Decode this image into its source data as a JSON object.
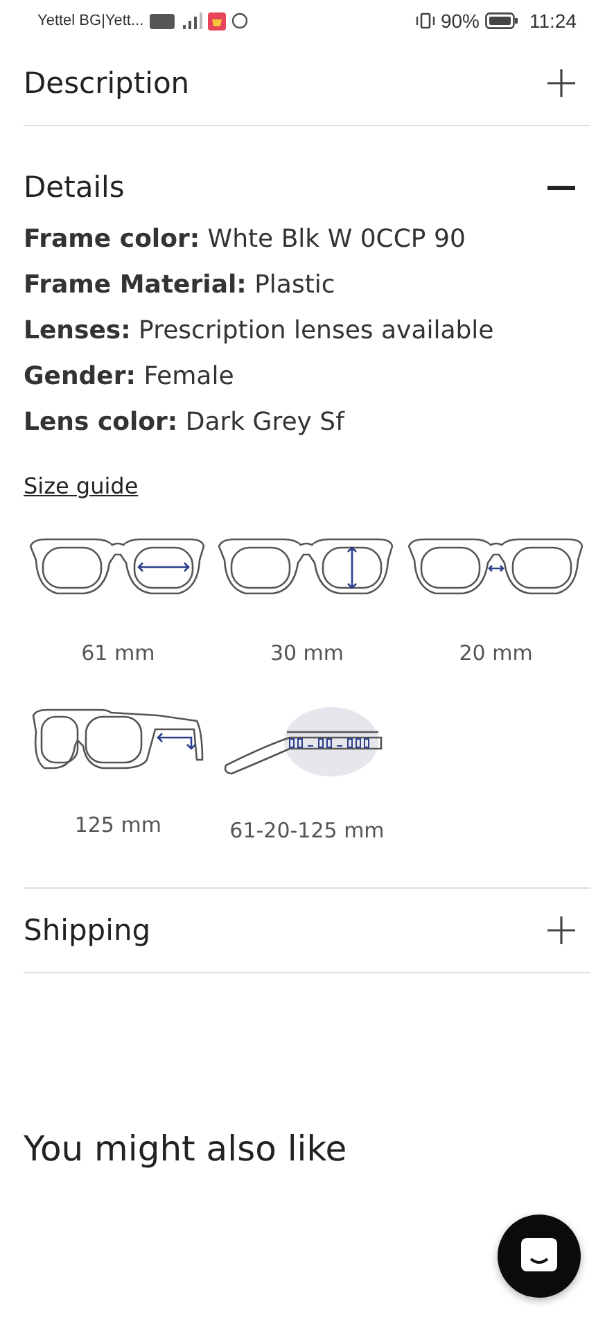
{
  "status_bar": {
    "carrier": "Yettel BG|Yett...",
    "battery_percent": "90%",
    "time": "11:24"
  },
  "sections": [
    {
      "title": "Description",
      "expanded": false
    },
    {
      "title": "Details",
      "expanded": true,
      "specs": [
        "**Frame color:** Whte Blk W 0CCP 90",
        "**Frame Material:** Plastic",
        "**Lenses:** Prescription lenses available",
        "**Gender:** Female",
        "**Lens color:** Dark Grey Sf"
      ],
      "size_guide": {
        "link": "Size guide",
        "items": [
          {
            "kind": "lens-width",
            "label": "61 mm"
          },
          {
            "kind": "lens-height",
            "label": "30 mm"
          },
          {
            "kind": "bridge",
            "label": "20 mm"
          },
          {
            "kind": "temple",
            "label": "125 mm"
          },
          {
            "kind": "inscription",
            "label": "61-20-125 mm"
          }
        ]
      }
    },
    {
      "title": "Shipping",
      "expanded": false
    }
  ],
  "recommendations": {
    "title": "You might also like"
  }
}
